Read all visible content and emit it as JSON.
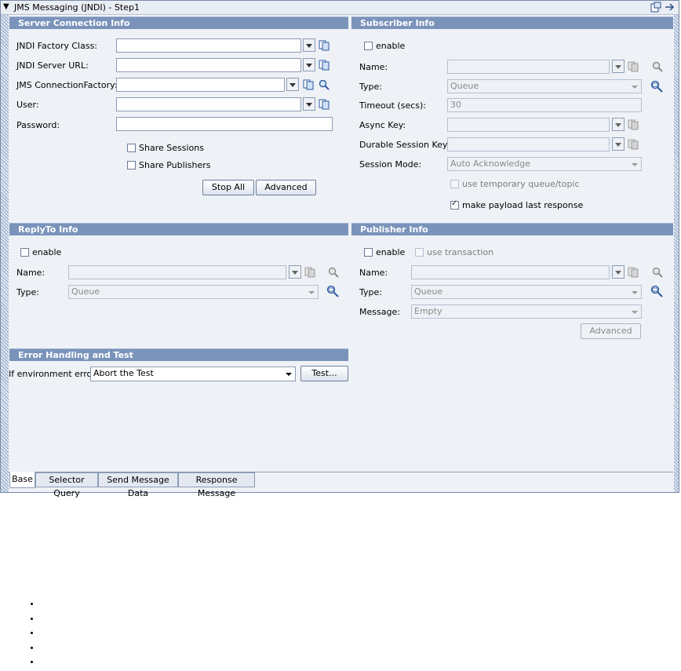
{
  "window": {
    "title": "JMS Messaging (JNDI) - Step1"
  },
  "server": {
    "header": "Server Connection Info",
    "factory_label": "JNDI Factory Class:",
    "url_label": "JNDI Server URL:",
    "conn_label": "JMS ConnectionFactory:",
    "user_label": "User:",
    "password_label": "Password:",
    "share_sessions": "Share Sessions",
    "share_publishers": "Share Publishers",
    "stop_all": "Stop All",
    "advanced": "Advanced"
  },
  "subscriber": {
    "header": "Subscriber Info",
    "enable": "enable",
    "name_label": "Name:",
    "type_label": "Type:",
    "type_value": "Queue",
    "timeout_label": "Timeout (secs):",
    "timeout_value": "30",
    "async_label": "Async Key:",
    "durable_label": "Durable Session Key:",
    "mode_label": "Session Mode:",
    "mode_value": "Auto Acknowledge",
    "temp_queue": "use temporary queue/topic",
    "payload_last": "make payload last response"
  },
  "replyto": {
    "header": "ReplyTo Info",
    "enable": "enable",
    "name_label": "Name:",
    "type_label": "Type:",
    "type_value": "Queue"
  },
  "publisher": {
    "header": "Publisher Info",
    "enable": "enable",
    "use_transaction": "use transaction",
    "name_label": "Name:",
    "type_label": "Type:",
    "type_value": "Queue",
    "message_label": "Message:",
    "message_value": "Empty",
    "advanced": "Advanced"
  },
  "error": {
    "header": "Error Handling and Test",
    "env_label": "If environment error:",
    "env_value": "Abort the Test",
    "test": "Test..."
  },
  "tabs": [
    "Base",
    "Selector Query",
    "Send Message Data",
    "Response Message"
  ]
}
